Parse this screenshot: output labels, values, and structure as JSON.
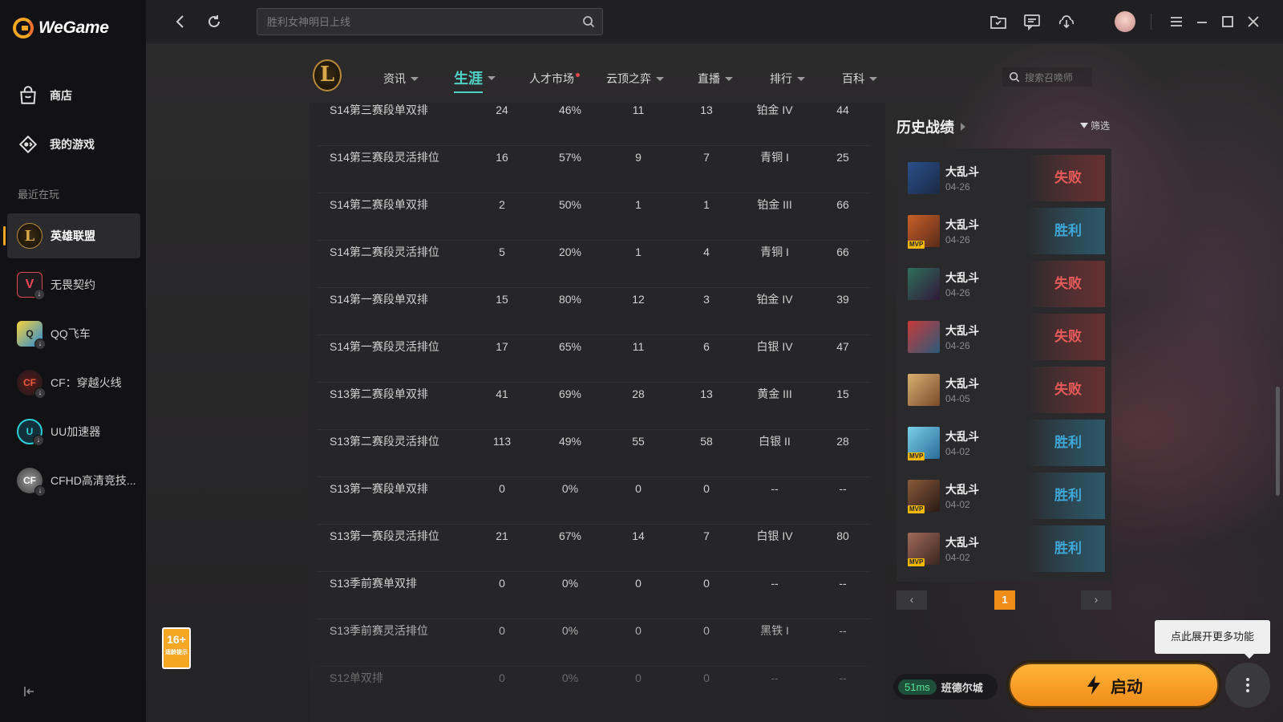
{
  "app": {
    "logo_text": "WeGame"
  },
  "sidebar": {
    "nav": [
      {
        "label": "商店",
        "icon": "shop-bag-icon"
      },
      {
        "label": "我的游戏",
        "icon": "gamepad-icon"
      }
    ],
    "recent_label": "最近在玩",
    "games": [
      {
        "label": "英雄联盟",
        "active": true
      },
      {
        "label": "无畏契约"
      },
      {
        "label": "QQ飞车"
      },
      {
        "label": "CF：穿越火线"
      },
      {
        "label": "UU加速器"
      },
      {
        "label": "CFHD高清竞技..."
      }
    ]
  },
  "topbar": {
    "search_placeholder": "胜利女神明日上线"
  },
  "game_nav": {
    "tabs": [
      {
        "label": "资讯"
      },
      {
        "label": "生涯",
        "active": true
      },
      {
        "label": "人才市场",
        "dot": true
      },
      {
        "label": "云顶之弈"
      },
      {
        "label": "直播"
      },
      {
        "label": "排行"
      },
      {
        "label": "百科"
      }
    ],
    "summoner_search_placeholder": "搜索召唤师"
  },
  "stats": {
    "rows": [
      [
        "S14第三赛段单双排",
        "24",
        "46%",
        "11",
        "13",
        "铂金 IV",
        "44"
      ],
      [
        "S14第三赛段灵活排位",
        "16",
        "57%",
        "9",
        "7",
        "青铜 I",
        "25"
      ],
      [
        "S14第二赛段单双排",
        "2",
        "50%",
        "1",
        "1",
        "铂金 III",
        "66"
      ],
      [
        "S14第二赛段灵活排位",
        "5",
        "20%",
        "1",
        "4",
        "青铜 I",
        "66"
      ],
      [
        "S14第一赛段单双排",
        "15",
        "80%",
        "12",
        "3",
        "铂金 IV",
        "39"
      ],
      [
        "S14第一赛段灵活排位",
        "17",
        "65%",
        "11",
        "6",
        "白银 IV",
        "47"
      ],
      [
        "S13第二赛段单双排",
        "41",
        "69%",
        "28",
        "13",
        "黄金 III",
        "15"
      ],
      [
        "S13第二赛段灵活排位",
        "113",
        "49%",
        "55",
        "58",
        "白银 II",
        "28"
      ],
      [
        "S13第一赛段单双排",
        "0",
        "0%",
        "0",
        "0",
        "--",
        "--"
      ],
      [
        "S13第一赛段灵活排位",
        "21",
        "67%",
        "14",
        "7",
        "白银 IV",
        "80"
      ],
      [
        "S13季前赛单双排",
        "0",
        "0%",
        "0",
        "0",
        "--",
        "--"
      ],
      [
        "S13季前赛灵活排位",
        "0",
        "0%",
        "0",
        "0",
        "黑铁 I",
        "--"
      ],
      [
        "S12单双排",
        "0",
        "0%",
        "0",
        "0",
        "--",
        "--"
      ]
    ]
  },
  "history": {
    "title": "历史战绩",
    "filter_label": "筛选",
    "items": [
      {
        "mode": "大乱斗",
        "date": "04-26",
        "result": "失败",
        "win": false,
        "mvp": false,
        "c1": "#2a4f8a",
        "c2": "#1a2a45"
      },
      {
        "mode": "大乱斗",
        "date": "04-26",
        "result": "胜利",
        "win": true,
        "mvp": true,
        "c1": "#c8602a",
        "c2": "#5a2a18"
      },
      {
        "mode": "大乱斗",
        "date": "04-26",
        "result": "失败",
        "win": false,
        "mvp": false,
        "c1": "#2f6e5a",
        "c2": "#301a3a"
      },
      {
        "mode": "大乱斗",
        "date": "04-26",
        "result": "失败",
        "win": false,
        "mvp": false,
        "c1": "#c83a3a",
        "c2": "#2a5a7a"
      },
      {
        "mode": "大乱斗",
        "date": "04-05",
        "result": "失败",
        "win": false,
        "mvp": false,
        "c1": "#d8b070",
        "c2": "#7a4a2a"
      },
      {
        "mode": "大乱斗",
        "date": "04-02",
        "result": "胜利",
        "win": true,
        "mvp": true,
        "c1": "#7ad0e8",
        "c2": "#2a6a9a"
      },
      {
        "mode": "大乱斗",
        "date": "04-02",
        "result": "胜利",
        "win": true,
        "mvp": true,
        "c1": "#8a5a3a",
        "c2": "#2a1a15"
      },
      {
        "mode": "大乱斗",
        "date": "04-02",
        "result": "胜利",
        "win": true,
        "mvp": true,
        "c1": "#a06a5a",
        "c2": "#3a2520"
      }
    ],
    "page": "1",
    "mvp_label": "MVP"
  },
  "launcher": {
    "tooltip": "点此展开更多功能",
    "ping": "51ms",
    "server": "班德尔城",
    "launch_label": "启动"
  },
  "age_rating": {
    "label": "16+",
    "sub": "适龄提示"
  }
}
